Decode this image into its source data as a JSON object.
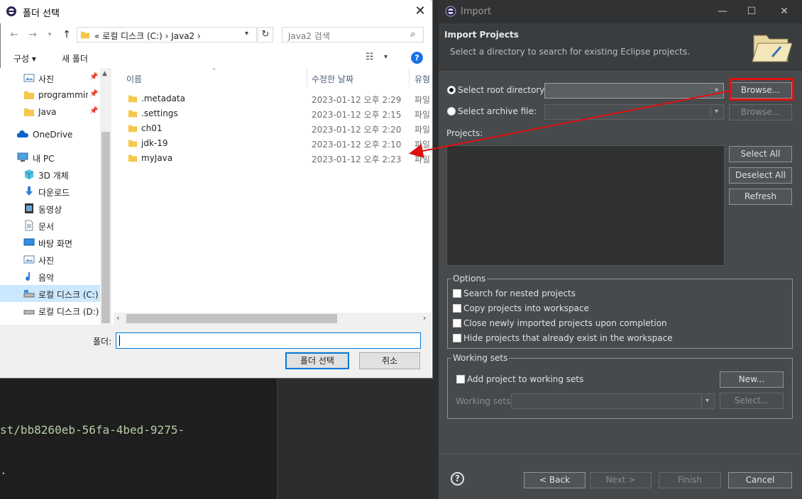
{
  "terminal": {
    "line1": "st/bb8260eb-56fa-4bed-9275-",
    "line2": "."
  },
  "folder_dialog": {
    "title": "폴더 선택",
    "close": "✕",
    "address": "« 로컬 디스크 (C:)  ›  Java2  ›",
    "search_placeholder": "Java2 검색",
    "organize": "구성 ▾",
    "new_folder": "새 폴더",
    "help": "?",
    "nav_items": [
      {
        "label": "사진",
        "icon": "pictures-icon",
        "pinned": true
      },
      {
        "label": "programming",
        "icon": "folder-icon",
        "pinned": true
      },
      {
        "label": "Java",
        "icon": "folder-icon",
        "pinned": true
      },
      {
        "label": "OneDrive",
        "icon": "onedrive-icon",
        "pinned": false
      },
      {
        "label": "내 PC",
        "icon": "pc-icon",
        "pinned": false
      },
      {
        "label": "3D 개체",
        "icon": "3d-objects-icon",
        "pinned": false
      },
      {
        "label": "다운로드",
        "icon": "downloads-icon",
        "pinned": false
      },
      {
        "label": "동영상",
        "icon": "videos-icon",
        "pinned": false
      },
      {
        "label": "문서",
        "icon": "documents-icon",
        "pinned": false
      },
      {
        "label": "바탕 화면",
        "icon": "desktop-icon",
        "pinned": false
      },
      {
        "label": "사진",
        "icon": "pictures-icon",
        "pinned": false
      },
      {
        "label": "음악",
        "icon": "music-icon",
        "pinned": false
      },
      {
        "label": "로컬 디스크 (C:)",
        "icon": "drive-icon",
        "pinned": false
      },
      {
        "label": "로컬 디스크 (D:)",
        "icon": "drive-icon",
        "pinned": false
      }
    ],
    "columns": {
      "name": "이름",
      "modified": "수정한 날짜",
      "type": "유형"
    },
    "files": [
      {
        "name": ".metadata",
        "modified": "2023-01-12 오후 2:29",
        "type": "파일"
      },
      {
        "name": ".settings",
        "modified": "2023-01-12 오후 2:15",
        "type": "파일"
      },
      {
        "name": "ch01",
        "modified": "2023-01-12 오후 2:20",
        "type": "파일"
      },
      {
        "name": "jdk-19",
        "modified": "2023-01-12 오후 2:10",
        "type": "파일"
      },
      {
        "name": "myJava",
        "modified": "2023-01-12 오후 2:23",
        "type": "파일"
      }
    ],
    "folder_label": "폴더:",
    "folder_value": "",
    "select_button": "폴더 선택",
    "cancel_button": "취소"
  },
  "import_dialog": {
    "title": "Import",
    "header_title": "Import Projects",
    "header_subtitle": "Select a directory to search for existing Eclipse projects.",
    "root_dir_label": "Select root directory:",
    "archive_label": "Select archive file:",
    "browse": "Browse...",
    "browse2": "Browse...",
    "projects_label": "Projects:",
    "select_all": "Select All",
    "deselect_all": "Deselect All",
    "refresh": "Refresh",
    "options_title": "Options",
    "options": [
      "Search for nested projects",
      "Copy projects into workspace",
      "Close newly imported projects upon completion",
      "Hide projects that already exist in the workspace"
    ],
    "working_sets_title": "Working sets",
    "add_to_ws": "Add project to working sets",
    "new_btn": "New...",
    "ws_label": "Working sets:",
    "ws_select": "Select...",
    "back": "< Back",
    "next": "Next >",
    "finish": "Finish",
    "cancel": "Cancel",
    "help": "?"
  },
  "colors": {
    "eclipse_bg": "#474a4c",
    "highlight_red": "#e01010",
    "win_accent": "#0078d7"
  }
}
